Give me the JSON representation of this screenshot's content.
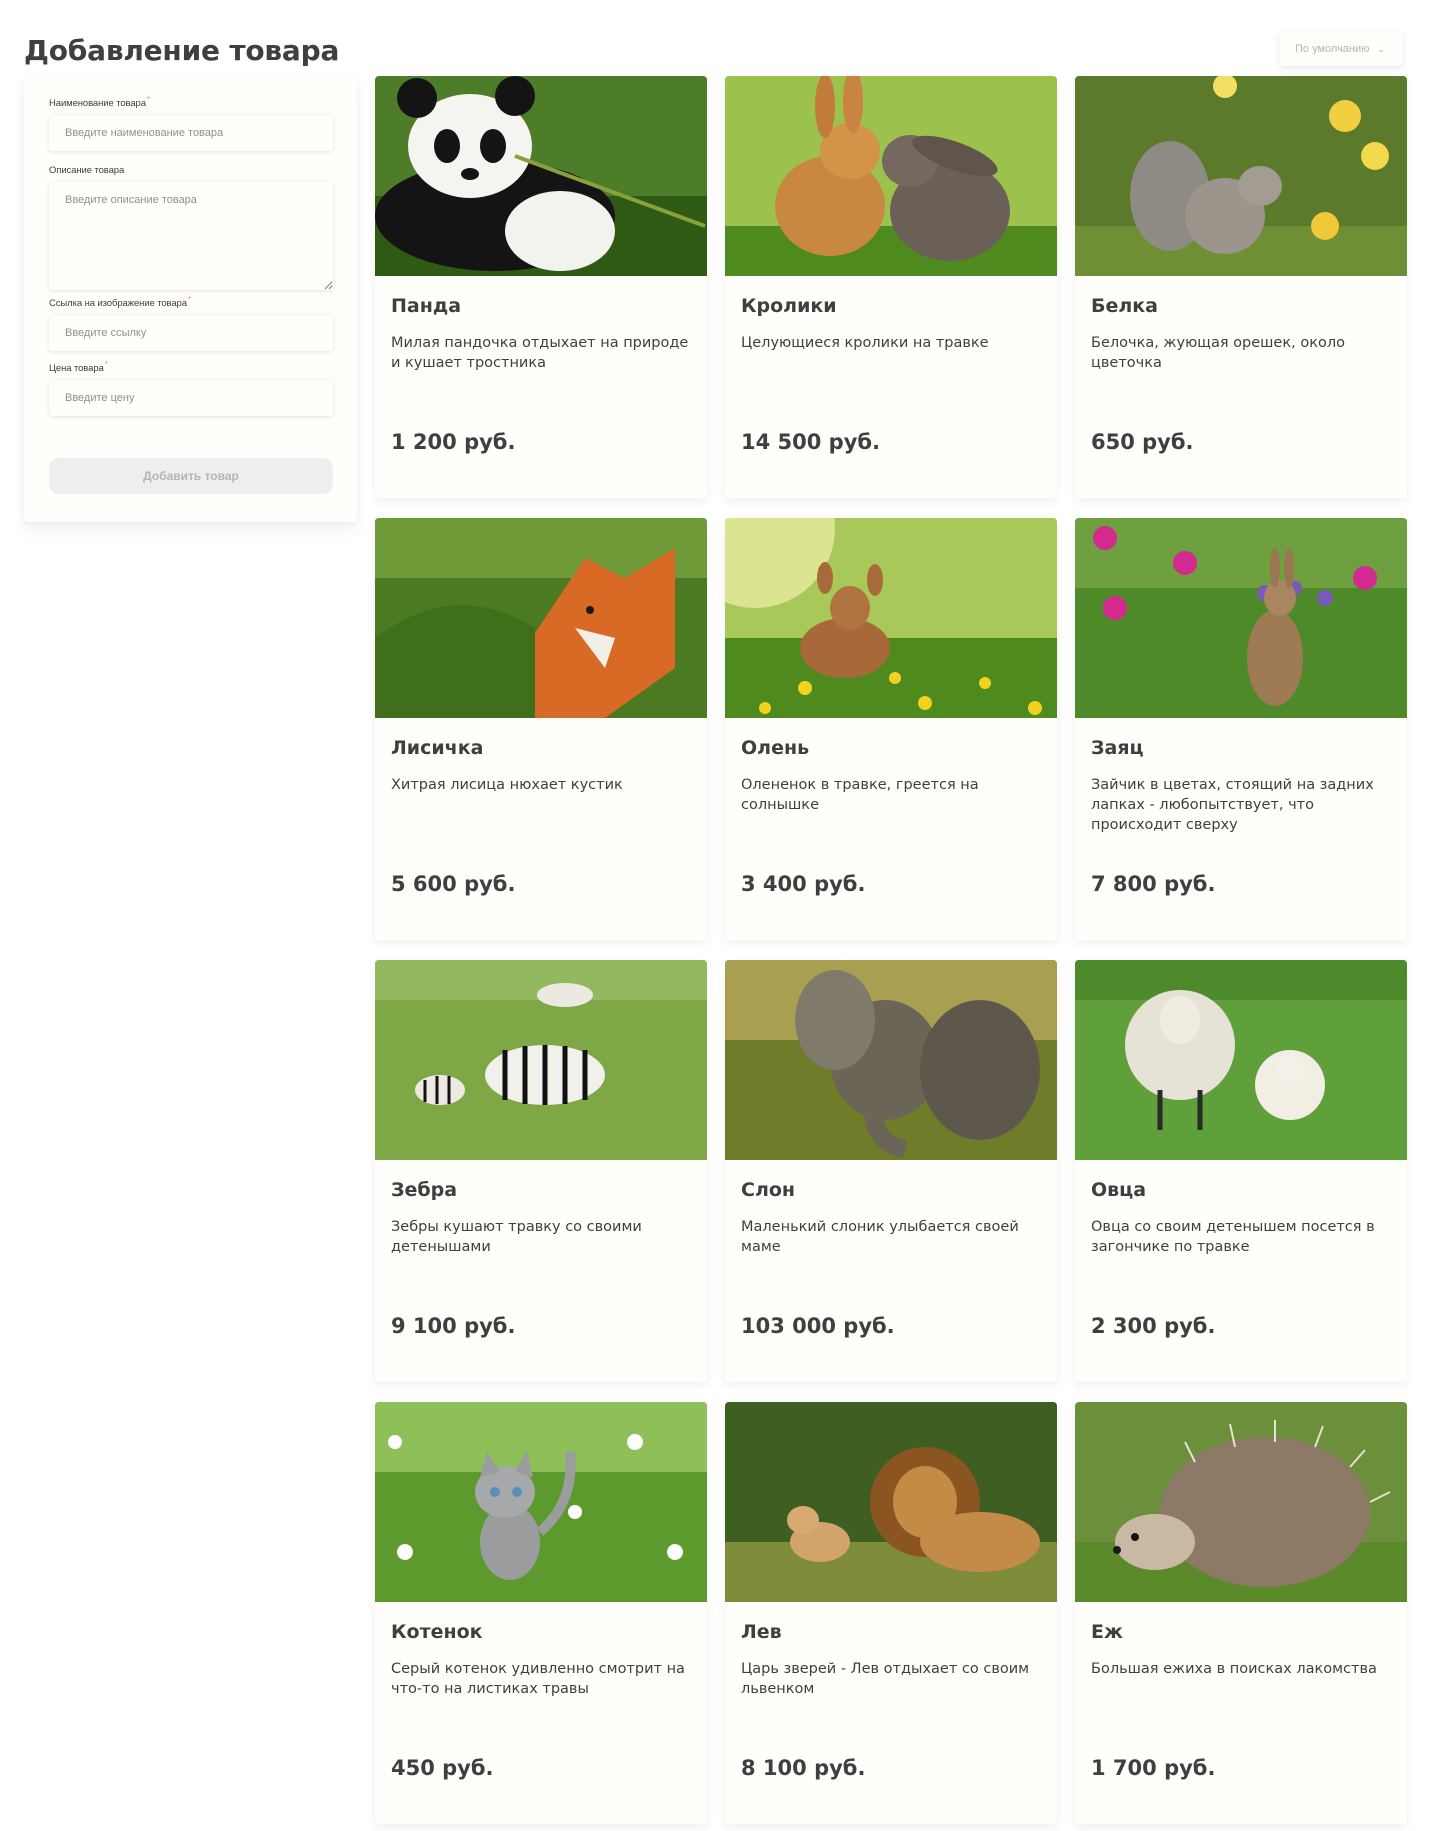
{
  "header": {
    "title": "Добавление товара",
    "sort_label": "По умолчанию"
  },
  "form": {
    "name_label": "Наименование товара",
    "name_placeholder": "Введите наименование товара",
    "description_label": "Описание товара",
    "description_placeholder": "Введите описание товара",
    "image_label": "Ссылка на изображение товара",
    "image_placeholder": "Введите ссылку",
    "price_label": "Цена товара",
    "price_placeholder": "Введите цену",
    "required_mark": "*",
    "submit_label": "Добавить товар"
  },
  "products": [
    {
      "title": "Панда",
      "description": "Милая пандочка отдыхает на природе и кушает тростника",
      "price": "1 200 руб.",
      "image": "panda"
    },
    {
      "title": "Кролики",
      "description": "Целующиеся кролики на травке",
      "price": "14 500 руб.",
      "image": "rabbits"
    },
    {
      "title": "Белка",
      "description": "Белочка, жующая орешек, около цветочка",
      "price": "650 руб.",
      "image": "squirrel"
    },
    {
      "title": "Лисичка",
      "description": "Хитрая лисица нюхает кустик",
      "price": "5 600 руб.",
      "image": "fox"
    },
    {
      "title": "Олень",
      "description": "Олененок в травке, греется на солнышке",
      "price": "3 400 руб.",
      "image": "fawn"
    },
    {
      "title": "Заяц",
      "description": "Зайчик в цветах, стоящий на задних лапках - любопытствует, что происходит сверху",
      "price": "7 800 руб.",
      "image": "hare"
    },
    {
      "title": "Зебра",
      "description": "Зебры кушают травку со своими детенышами",
      "price": "9 100 руб.",
      "image": "zebra"
    },
    {
      "title": "Слон",
      "description": "Маленький слоник улыбается своей маме",
      "price": "103 000 руб.",
      "image": "elephant"
    },
    {
      "title": "Овца",
      "description": "Овца со своим детенышем посется в загончике по травке",
      "price": "2 300 руб.",
      "image": "sheep"
    },
    {
      "title": "Котенок",
      "description": "Серый котенок удивленно смотрит на что-то на листиках травы",
      "price": "450 руб.",
      "image": "kitten"
    },
    {
      "title": "Лев",
      "description": "Царь зверей - Лев отдыхает со своим львенком",
      "price": "8 100 руб.",
      "image": "lion"
    },
    {
      "title": "Еж",
      "description": "Большая ежиха в поисках лакомства",
      "price": "1 700 руб.",
      "image": "hedgehog"
    }
  ]
}
